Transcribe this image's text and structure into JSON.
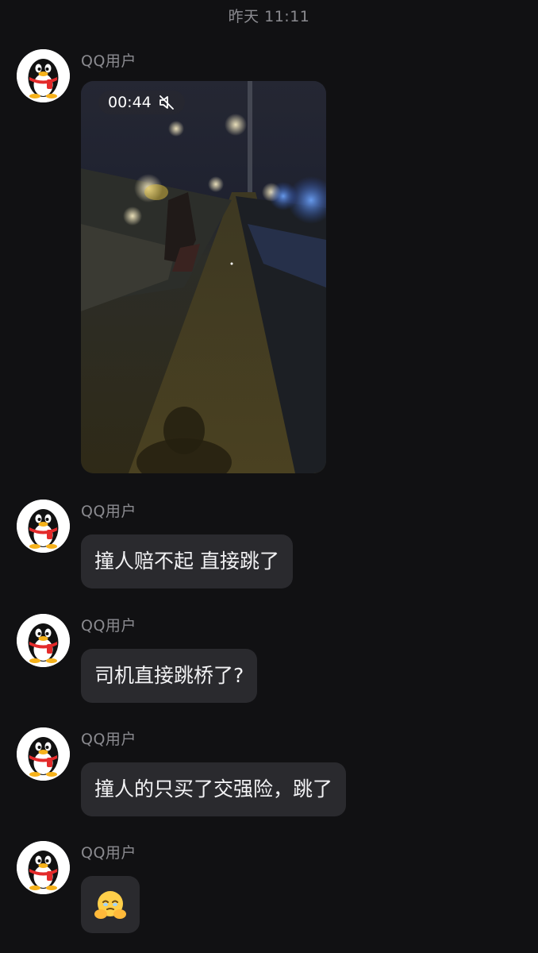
{
  "timestamp": "昨天 11:11",
  "messages": [
    {
      "sender": "QQ用户",
      "type": "video",
      "duration": "00:44",
      "muted": true
    },
    {
      "sender": "QQ用户",
      "type": "text",
      "text": "撞人赔不起 直接跳了"
    },
    {
      "sender": "QQ用户",
      "type": "text",
      "text": "司机直接跳桥了?"
    },
    {
      "sender": "QQ用户",
      "type": "text",
      "text": "撞人的只买了交强险，跳了"
    },
    {
      "sender": "QQ用户",
      "type": "sticker",
      "emoji": "face-holding-back-tears-emoji"
    }
  ],
  "colors": {
    "background": "#111113",
    "bubble": "#2a2a2e",
    "text": "#f2f2f4",
    "meta": "#8b8b90"
  },
  "icons": {
    "avatar": "qq-penguin-icon",
    "mute": "speaker-muted-icon"
  }
}
